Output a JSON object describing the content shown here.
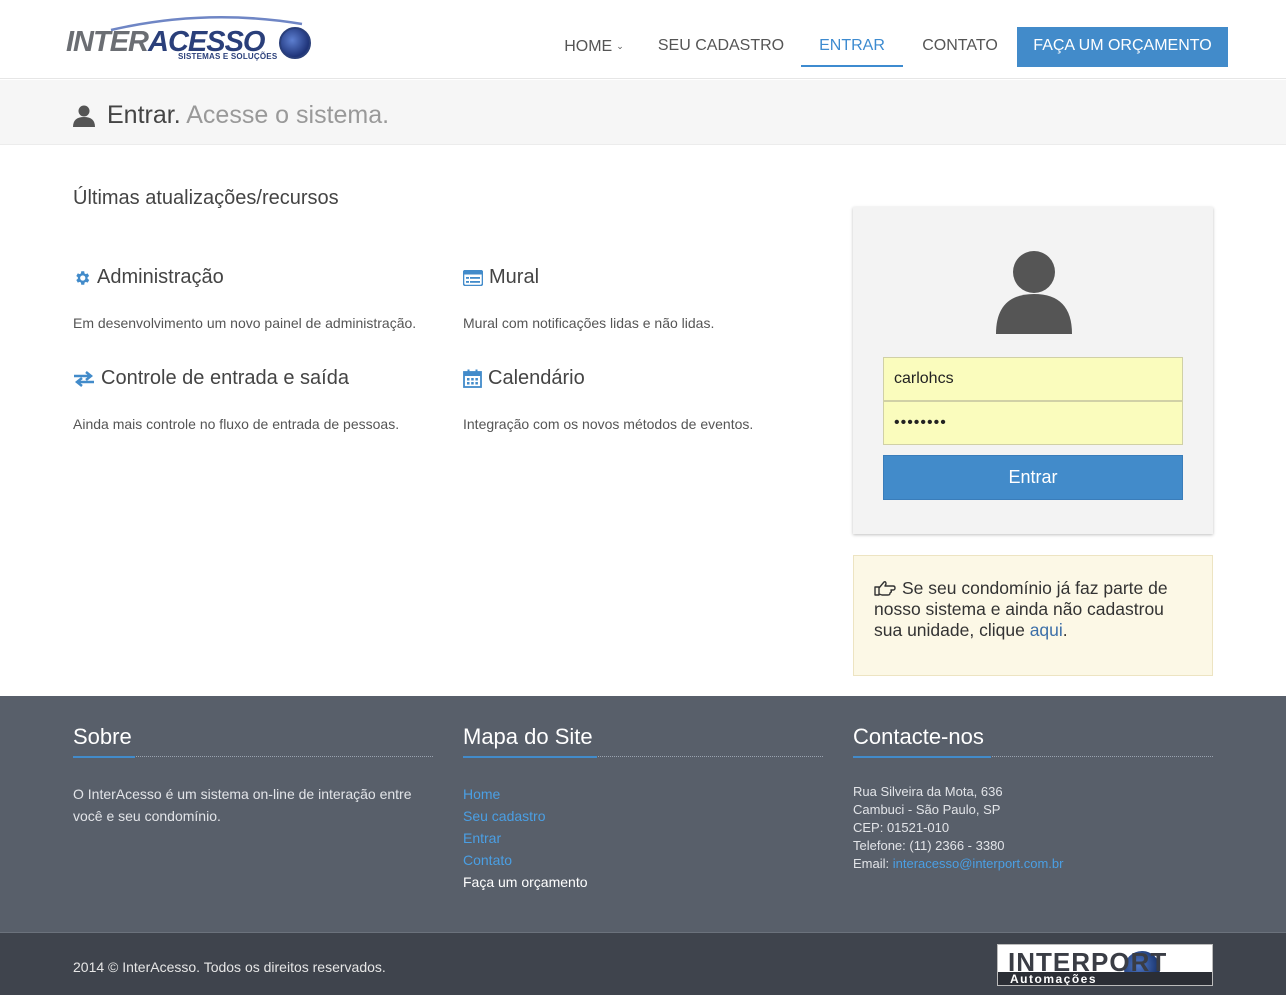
{
  "header": {
    "logo_main": "INTERACESSO",
    "logo_tagline": "SISTEMAS E SOLUÇÕES",
    "nav": [
      {
        "label": "HOME"
      },
      {
        "label": "SEU CADASTRO"
      },
      {
        "label": "ENTRAR"
      },
      {
        "label": "CONTATO"
      }
    ],
    "cta_label": "FAÇA UM ORÇAMENTO"
  },
  "page": {
    "title": "Entrar.",
    "subtitle": "Acesse o sistema."
  },
  "features": {
    "section_title": "Últimas atualizações/recursos",
    "items": [
      {
        "title": "Administração",
        "text": "Em desenvolvimento um novo painel de administração.",
        "icon": "gear-icon"
      },
      {
        "title": "Mural",
        "text": "Mural com notificações lidas e não lidas.",
        "icon": "list-icon"
      },
      {
        "title": "Controle de entrada e saída",
        "text": "Ainda mais controle no fluxo de entrada de pessoas.",
        "icon": "exchange-icon"
      },
      {
        "title": "Calendário",
        "text": "Integração com os novos métodos de eventos.",
        "icon": "calendar-icon"
      }
    ]
  },
  "login": {
    "username": "carlohcs",
    "password_mask": "••••••••",
    "button_label": "Entrar"
  },
  "notice": {
    "text": "Se seu condomínio já faz parte de nosso sistema e ainda não cadastrou sua unidade, clique",
    "link_label": "aqui",
    "suffix": "."
  },
  "footer": {
    "about": {
      "title": "Sobre",
      "text": "O InterAcesso é um sistema on-line de interação entre você e seu condomínio."
    },
    "sitemap": {
      "title": "Mapa do Site",
      "links": [
        "Home",
        "Seu cadastro",
        "Entrar",
        "Contato",
        "Faça um orçamento"
      ]
    },
    "contact": {
      "title": "Contacte-nos",
      "address": "Rua Silveira da Mota, 636",
      "district": "Cambuci - São Paulo, SP",
      "cep": "CEP: 01521-010",
      "phone": "Telefone: (11) 2366 - 3380",
      "email_label": "Email:",
      "email": "interacesso@interport.com.br"
    },
    "copyright": "2014 © InterAcesso. Todos os direitos reservados.",
    "partner_logo_main": "INTERPORT",
    "partner_logo_sub": "Automações"
  },
  "colors": {
    "primary": "#428bca",
    "footer_bg": "#585f6a",
    "copy_bg": "#3f444d",
    "input_bg": "#fafcbd",
    "notice_bg": "#fcf8e6"
  }
}
